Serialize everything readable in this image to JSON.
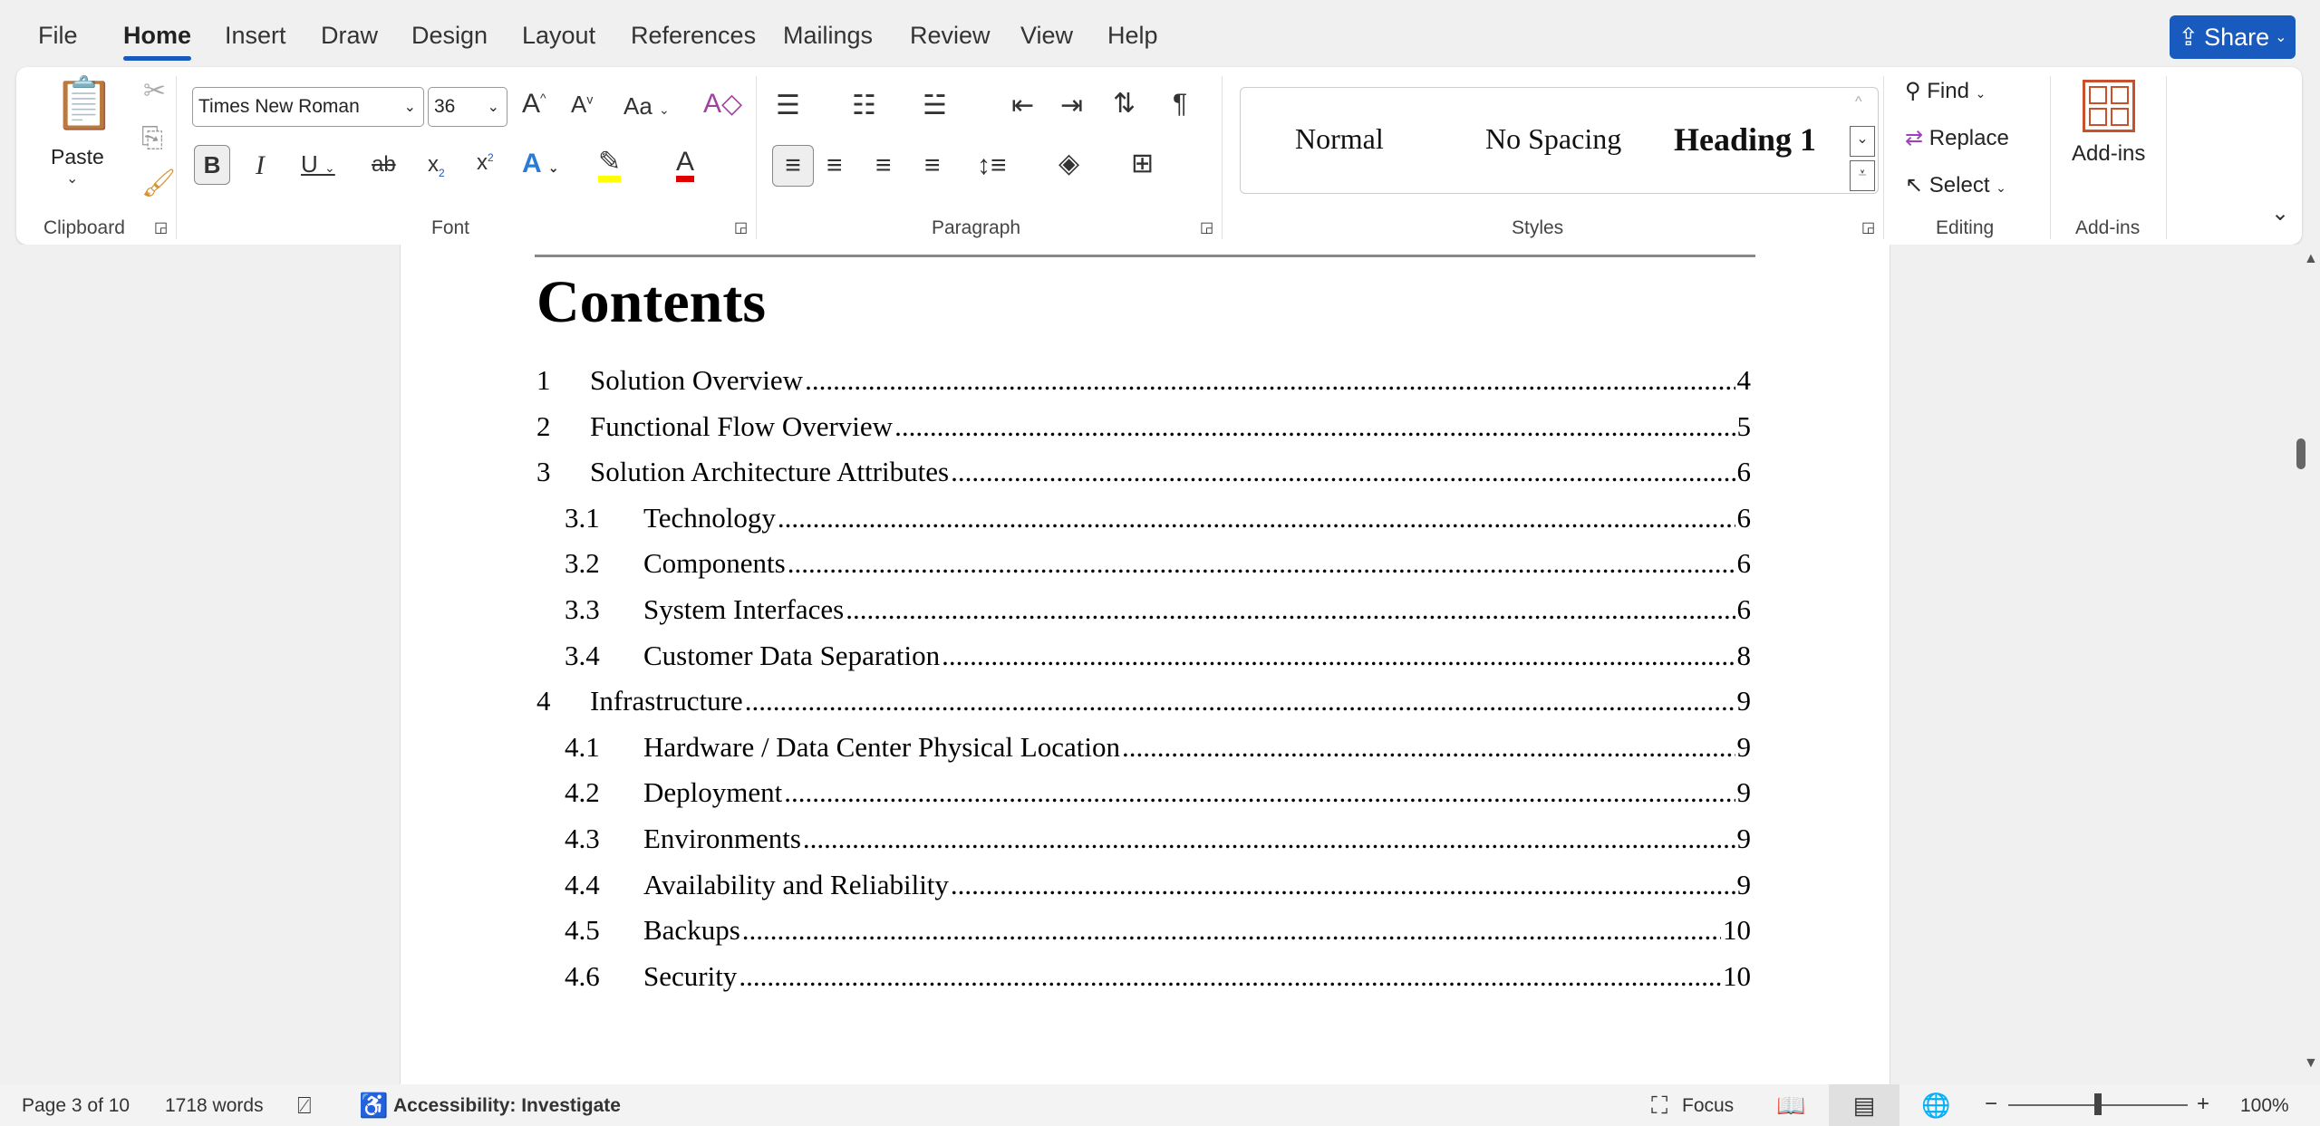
{
  "tabs": [
    "File",
    "Home",
    "Insert",
    "Draw",
    "Design",
    "Layout",
    "References",
    "Mailings",
    "Review",
    "View",
    "Help"
  ],
  "active_tab": "Home",
  "share_label": "Share",
  "ribbon": {
    "clipboard": {
      "paste": "Paste",
      "label": "Clipboard"
    },
    "font": {
      "name": "Times New Roman",
      "size": "36",
      "label": "Font",
      "case": "Aa"
    },
    "paragraph": {
      "label": "Paragraph"
    },
    "styles": {
      "items": [
        "Normal",
        "No Spacing",
        "Heading 1"
      ],
      "label": "Styles"
    },
    "editing": {
      "find": "Find",
      "replace": "Replace",
      "select": "Select",
      "label": "Editing"
    },
    "addins": {
      "button": "Add-ins",
      "label": "Add-ins"
    }
  },
  "colors": {
    "accent": "#185abd",
    "highlight": "#ffff00",
    "font_color": "#e00000",
    "addins": "#c8502a"
  },
  "document": {
    "heading": "Contents",
    "toc": [
      {
        "num": "1",
        "title": "Solution Overview",
        "page": "4",
        "level": 1
      },
      {
        "num": "2",
        "title": "Functional Flow Overview",
        "page": "5",
        "level": 1
      },
      {
        "num": "3",
        "title": "Solution Architecture Attributes",
        "page": "6",
        "level": 1
      },
      {
        "num": "3.1",
        "title": "Technology",
        "page": "6",
        "level": 2
      },
      {
        "num": "3.2",
        "title": "Components",
        "page": "6",
        "level": 2
      },
      {
        "num": "3.3",
        "title": "System Interfaces",
        "page": "6",
        "level": 2
      },
      {
        "num": "3.4",
        "title": "Customer Data Separation",
        "page": "8",
        "level": 2
      },
      {
        "num": "4",
        "title": "Infrastructure",
        "page": "9",
        "level": 1
      },
      {
        "num": "4.1",
        "title": "Hardware / Data Center Physical Location",
        "page": "9",
        "level": 2
      },
      {
        "num": "4.2",
        "title": "Deployment",
        "page": "9",
        "level": 2
      },
      {
        "num": "4.3",
        "title": "Environments",
        "page": "9",
        "level": 2
      },
      {
        "num": "4.4",
        "title": "Availability and Reliability",
        "page": "9",
        "level": 2
      },
      {
        "num": "4.5",
        "title": "Backups",
        "page": "10",
        "level": 2
      },
      {
        "num": "4.6",
        "title": "Security",
        "page": "10",
        "level": 2
      }
    ]
  },
  "status": {
    "page": "Page 3 of 10",
    "words": "1718 words",
    "accessibility": "Accessibility: Investigate",
    "focus": "Focus",
    "zoom": "100%",
    "zoom_value": 100
  }
}
